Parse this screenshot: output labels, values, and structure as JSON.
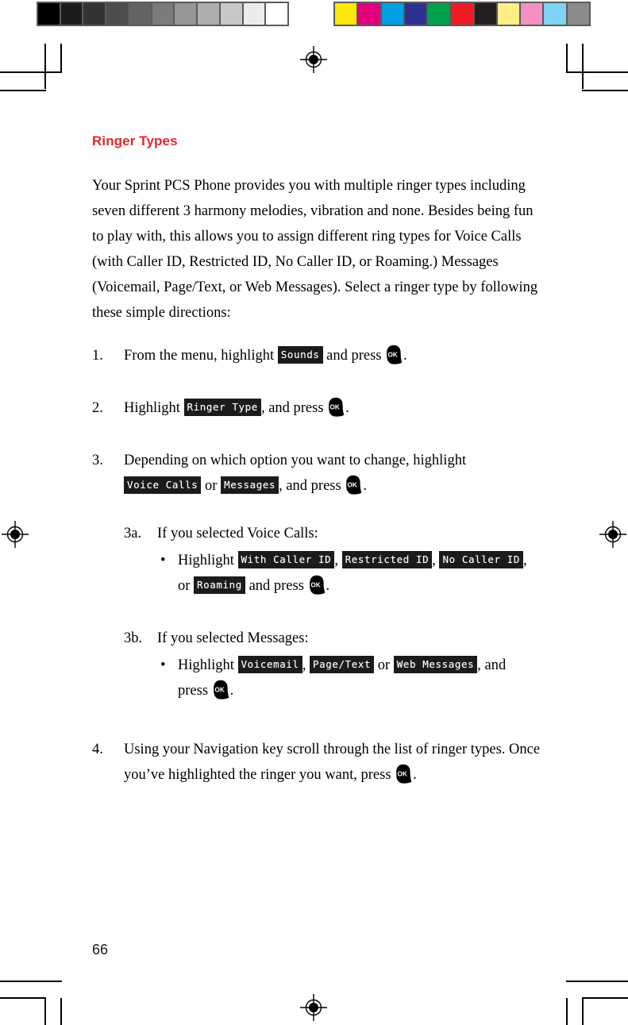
{
  "calibration": {
    "grayscale_label": "grayscale-calibration-bar",
    "grayscale_swatches": [
      "#000000",
      "#1c1c1c",
      "#333333",
      "#4d4d4d",
      "#636363",
      "#7b7b7b",
      "#969696",
      "#aeaeae",
      "#c8c8c8",
      "#ececec",
      "#ffffff"
    ],
    "color_label": "color-calibration-bar",
    "color_swatches": [
      "#fbe60d",
      "#e3007f",
      "#00a0e4",
      "#2e3192",
      "#00a14b",
      "#ed1c24",
      "#231f20",
      "#fdef85",
      "#f490c4",
      "#7fd4f5",
      "#8c8c8c"
    ]
  },
  "page": {
    "number": "66",
    "title": "Ringer Types",
    "title_color": "#e8232a",
    "intro": "Your Sprint PCS Phone provides you with multiple ringer types including seven different 3 harmony melodies, vibration and none. Besides being fun to play with, this allows you to assign different ring types for Voice Calls (with Caller ID, Restricted ID, No Caller ID, or Roaming.) Messages (Voicemail, Page/Text, or Web Messages). Select a ringer type by following these simple directions:"
  },
  "steps": {
    "step1": {
      "num": "1.",
      "text_before": "From the menu, highlight",
      "menu_item": "Sounds",
      "text_after": "and press",
      "text_end": "."
    },
    "step2": {
      "num": "2.",
      "text_before": "Highlight",
      "menu_item": "Ringer Type",
      "text_after": ", and press",
      "text_end": "."
    },
    "step3": {
      "num": "3.",
      "text_before": "Depending on which option you want to change, highlight",
      "menu_item_1": "Voice Calls",
      "conjunction": "or",
      "menu_item_2": "Messages",
      "text_after": ", and press",
      "text_end": "."
    },
    "step3a": {
      "label": "3a.",
      "heading": "If you selected Voice Calls:",
      "bullet": "•",
      "bullet_lead": "Highlight",
      "menu_item_1": "With Caller ID",
      "sep_1": ",",
      "menu_item_2": "Restricted ID",
      "sep_2": ",",
      "menu_item_3": "No Caller ID",
      "conjunction": ", or",
      "menu_item_4": "Roaming",
      "text_after": "and press",
      "text_end": "."
    },
    "step3b": {
      "label": "3b.",
      "heading": "If you selected Messages:",
      "bullet": "•",
      "bullet_lead": "Highlight",
      "menu_item_1": "Voicemail",
      "sep_1": ",",
      "menu_item_2": "Page/Text",
      "conjunction": "or",
      "menu_item_3": "Web Messages",
      "text_after": ", and",
      "press_label": "press",
      "text_end": "."
    },
    "step4": {
      "num": "4.",
      "text_before": "Using your Navigation key scroll through the list of ringer types. Once you’ve highlighted the ringer you want, press",
      "text_end": "."
    }
  },
  "keys": {
    "ok_label": "OK"
  }
}
